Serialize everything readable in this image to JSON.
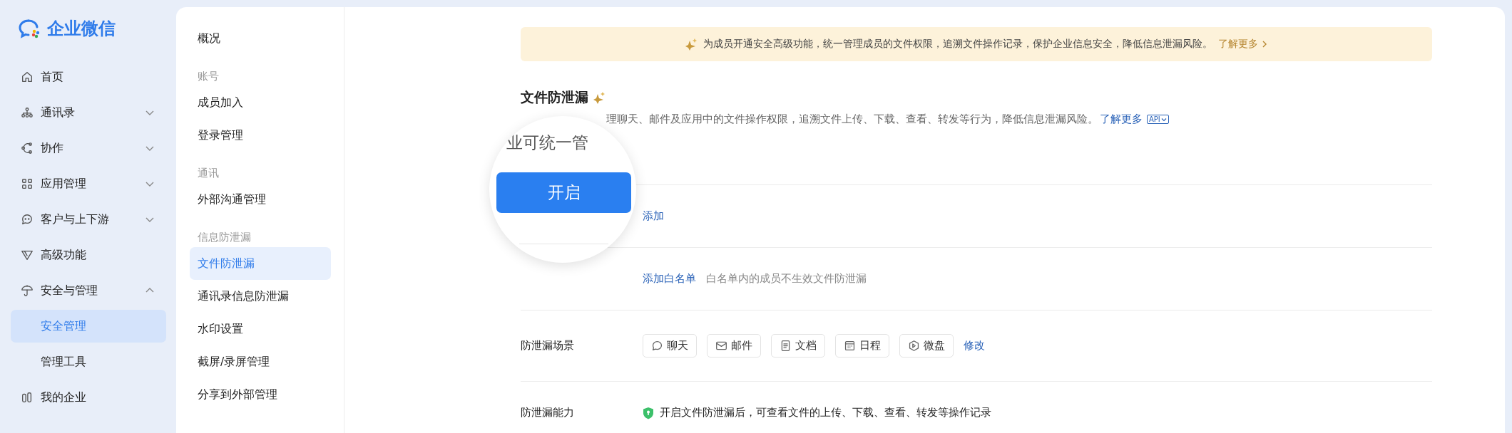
{
  "logo": {
    "text": "企业微信"
  },
  "nav": [
    {
      "label": "首页",
      "kind": "home"
    },
    {
      "label": "通讯录",
      "kind": "org",
      "expanded": false
    },
    {
      "label": "协作",
      "kind": "collab",
      "expanded": false
    },
    {
      "label": "应用管理",
      "kind": "apps",
      "expanded": false
    },
    {
      "label": "客户与上下游",
      "kind": "chat",
      "expanded": false
    },
    {
      "label": "高级功能",
      "kind": "premium"
    },
    {
      "label": "安全与管理",
      "kind": "umbrella",
      "expanded": true,
      "children": [
        {
          "label": "安全管理",
          "selected": true
        },
        {
          "label": "管理工具",
          "selected": false
        }
      ]
    },
    {
      "label": "我的企业",
      "kind": "building"
    }
  ],
  "subnav": [
    {
      "items": [
        {
          "label": "概况",
          "selected": false
        }
      ]
    },
    {
      "heading": "账号",
      "items": [
        {
          "label": "成员加入",
          "selected": false
        },
        {
          "label": "登录管理",
          "selected": false
        }
      ]
    },
    {
      "heading": "通讯",
      "items": [
        {
          "label": "外部沟通管理",
          "selected": false
        }
      ]
    },
    {
      "heading": "信息防泄漏",
      "items": [
        {
          "label": "文件防泄漏",
          "selected": true
        },
        {
          "label": "通讯录信息防泄漏",
          "selected": false
        },
        {
          "label": "水印设置",
          "selected": false
        },
        {
          "label": "截屏/录屏管理",
          "selected": false
        },
        {
          "label": "分享到外部管理",
          "selected": false
        }
      ]
    }
  ],
  "banner": {
    "text": "为成员开通安全高级功能，统一管理成员的文件权限，追溯文件操作记录，保护企业信息安全，降低信息泄漏风险。",
    "link": "了解更多"
  },
  "title": "文件防泄漏",
  "description": {
    "text": "理聊天、邮件及应用中的文件操作权限，追溯文件上传、下载、查看、转发等行为，降低信息泄漏风险。",
    "link": "了解更多",
    "badge": "API"
  },
  "magnifier": {
    "text": "业可统一管",
    "button": "开启"
  },
  "rows": [
    {
      "kind": "link",
      "link": "添加"
    },
    {
      "kind": "link",
      "link": "添加白名单",
      "hint": "白名单内的成员不生效文件防泄漏"
    },
    {
      "kind": "chips",
      "label": "防泄漏场景",
      "chips": [
        {
          "label": "聊天",
          "kind": "chat"
        },
        {
          "label": "邮件",
          "kind": "mail"
        },
        {
          "label": "文档",
          "kind": "doc"
        },
        {
          "label": "日程",
          "kind": "calendar"
        },
        {
          "label": "微盘",
          "kind": "drive"
        }
      ],
      "link": "修改"
    },
    {
      "kind": "feature",
      "label": "防泄漏能力",
      "text": "开启文件防泄漏后，可查看文件的上传、下载、查看、转发等操作记录"
    }
  ]
}
